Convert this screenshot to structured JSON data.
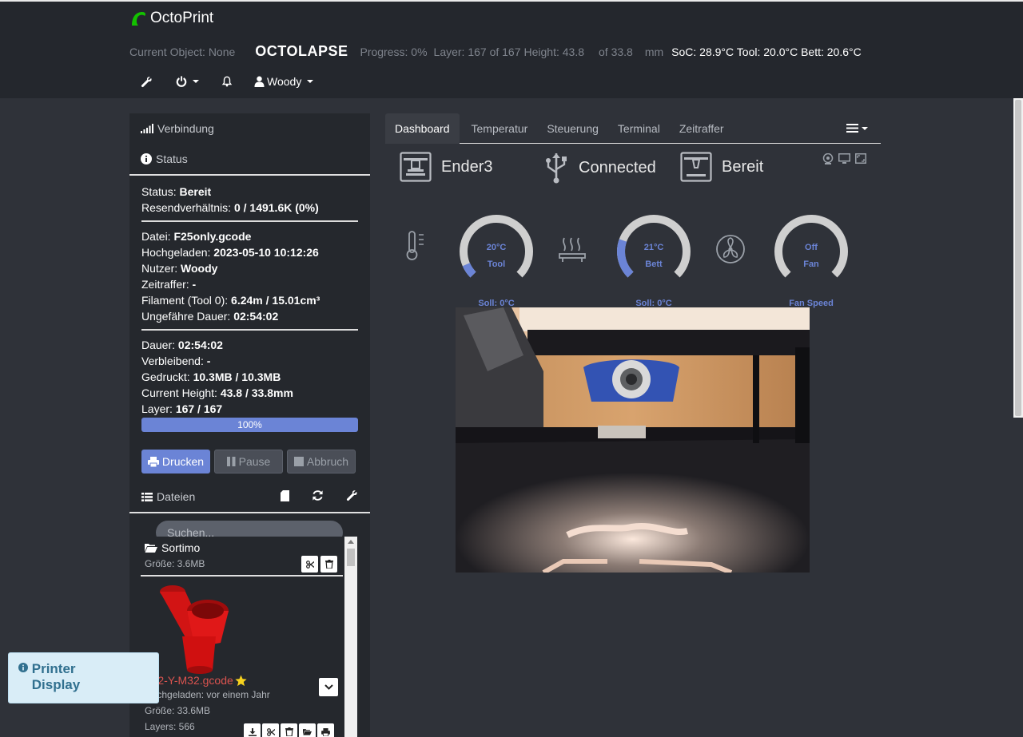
{
  "brand": {
    "name": "OctoPrint"
  },
  "header": {
    "current_object": "Current Object: None",
    "octolapse": "OCTOLAPSE",
    "progress": "Progress: 0%",
    "layer": "Layer: 167 of 167",
    "height": "Height: 43.8",
    "of_height": "of 33.8",
    "unit": "mm",
    "temps": "SoC: 28.9°C Tool: 20.0°C Bett: 20.6°C",
    "user": "Woody"
  },
  "sidebar": {
    "connection_label": "Verbindung",
    "status_label": "Status",
    "status": {
      "status_k": "Status:",
      "status_v": "Bereit",
      "resend_k": "Resendverhältnis:",
      "resend_v": "0 / 1491.6K (0%)",
      "file_k": "Datei:",
      "file_v": "F25only.gcode",
      "uploaded_k": "Hochgeladen:",
      "uploaded_v": "2023-05-10 10:12:26",
      "user_k": "Nutzer:",
      "user_v": "Woody",
      "timelapse_k": "Zeitraffer:",
      "timelapse_v": "-",
      "filament_k": "Filament (Tool 0):",
      "filament_v": "6.24m / 15.01cm³",
      "est_k": "Ungefähre Dauer:",
      "est_v": "02:54:02",
      "dur_k": "Dauer:",
      "dur_v": "02:54:02",
      "left_k": "Verbleibend:",
      "left_v": "-",
      "printed_k": "Gedruckt:",
      "printed_v": "10.3MB / 10.3MB",
      "curh_k": "Current Height:",
      "curh_v": "43.8 / 33.8mm",
      "layer_k": "Layer:",
      "layer_v": "167 / 167"
    },
    "progress_text": "100%",
    "progress_value": 1.0,
    "buttons": {
      "print": "Drucken",
      "pause": "Pause",
      "cancel": "Abbruch"
    },
    "files_label": "Dateien",
    "search_placeholder": "Suchen...",
    "folder": {
      "name": "Sortimo",
      "size": "Größe: 3.6MB"
    },
    "file": {
      "name": "F32-Y-M32.gcode",
      "uploaded": "Hochgeladen: vor einem Jahr",
      "size": "Größe: 33.6MB",
      "layers": "Layers: 566"
    }
  },
  "printer_display": "Printer Display",
  "tabs": [
    "Dashboard",
    "Temperatur",
    "Steuerung",
    "Terminal",
    "Zeitraffer"
  ],
  "dashboard": {
    "printer_name": "Ender3",
    "connection": "Connected",
    "state": "Bereit",
    "gauges": [
      {
        "value_text": "20°C",
        "name": "Tool",
        "target": "Soll: 0°C",
        "level": 0.08
      },
      {
        "value_text": "21°C",
        "name": "Bett",
        "target": "Soll: 0°C",
        "level": 0.24
      },
      {
        "value_text": "Off",
        "name": "Fan",
        "target": "Fan Speed",
        "level": 0
      }
    ]
  },
  "colors": {
    "accent": "#6b84d6",
    "topbar": "#24272d",
    "background": "#2f3239",
    "danger": "#d9534f"
  }
}
